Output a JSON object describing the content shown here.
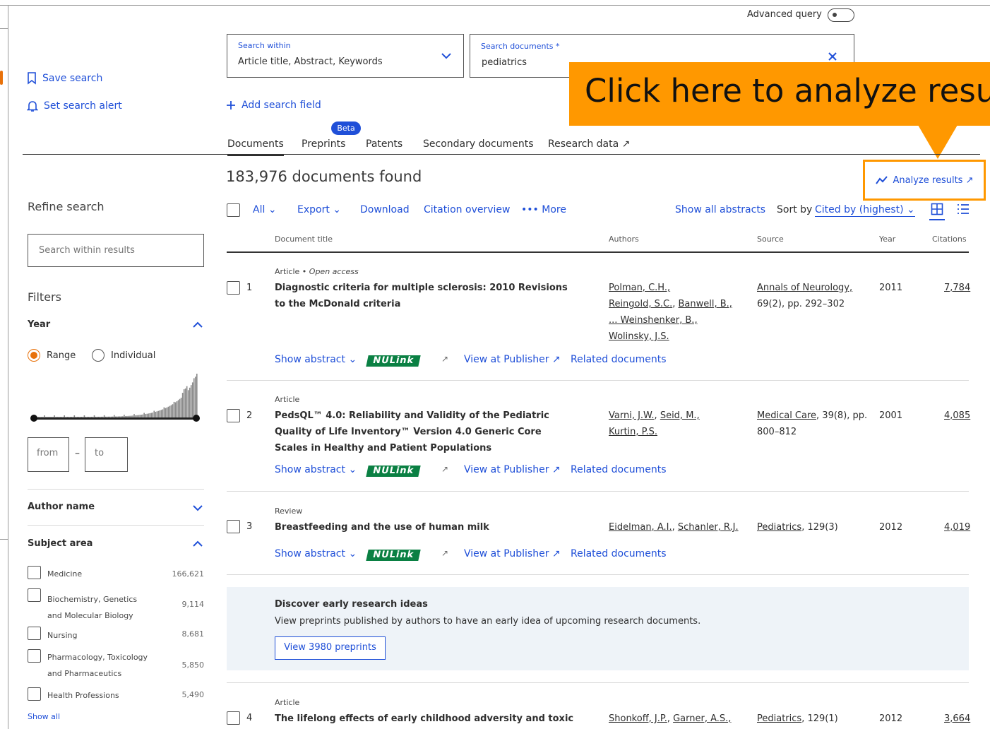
{
  "header": {
    "advanced_query_label": "Advanced query",
    "search_within_label": "Search within",
    "search_within_value": "Article title, Abstract, Keywords",
    "search_documents_label": "Search documents *",
    "search_documents_value": "pediatrics",
    "add_search_field": "Add search field",
    "save_search": "Save search",
    "set_search_alert": "Set search alert"
  },
  "tabs": {
    "beta_badge": "Beta",
    "items": [
      "Documents",
      "Preprints",
      "Patents",
      "Secondary documents",
      "Research data ↗"
    ]
  },
  "callout": {
    "text": "Click here to analyze resu"
  },
  "results": {
    "count_text": "183,976 documents found",
    "analyze_results": "Analyze results ↗"
  },
  "toolbar": {
    "all": "All",
    "export": "Export",
    "download": "Download",
    "citation_overview": "Citation overview",
    "more": "More",
    "show_all_abstracts": "Show all abstracts",
    "sort_by_label": "Sort by",
    "sort_by_value": "Cited by (highest)"
  },
  "columns": {
    "title": "Document title",
    "authors": "Authors",
    "source": "Source",
    "year": "Year",
    "citations": "Citations"
  },
  "row_actions": {
    "show_abstract": "Show abstract",
    "nulink": "NULink",
    "view_publisher": "View at Publisher ↗",
    "related": "Related documents"
  },
  "documents": [
    {
      "num": "1",
      "type": "Article",
      "open_access": "Open access",
      "title": "Diagnostic criteria for multiple sclerosis: 2010 Revisions to the McDonald criteria",
      "authors_line1": "Polman, C.H.,",
      "authors_line2a": "Reingold, S.C.",
      "authors_line2b": "Banwell, B.,",
      "authors_line3": "... Weinshenker, B.,",
      "authors_line4": "Wolinsky, J.S.",
      "source_name": "Annals of Neurology,",
      "source_detail": "69(2), pp. 292–302",
      "year": "2011",
      "citations": "7,784"
    },
    {
      "num": "2",
      "type": "Article",
      "title": "PedsQL™ 4.0: Reliability and Validity of the Pediatric Quality of Life Inventory™ Version 4.0 Generic Core Scales in Healthy and Patient Populations",
      "authors_line1a": "Varni, J.W.",
      "authors_line1b": "Seid, M.,",
      "authors_line2": "Kurtin, P.S.",
      "source_name": "Medical Care",
      "source_detail_a": ", 39(8), pp.",
      "source_detail_b": "800–812",
      "year": "2001",
      "citations": "4,085"
    },
    {
      "num": "3",
      "type": "Review",
      "title": "Breastfeeding and the use of human milk",
      "authors_a": "Eidelman, A.I.",
      "authors_b": "Schanler, R.J.",
      "source_name": "Pediatrics",
      "source_detail": ", 129(3)",
      "year": "2012",
      "citations": "4,019"
    },
    {
      "num": "4",
      "type": "Article",
      "title": "The lifelong effects of early childhood adversity and toxic stress",
      "authors_a": "Shonkoff, J.P.",
      "authors_b": "Garner, A.S.,",
      "source_name": "Pediatrics",
      "source_detail": ", 129(1)",
      "year": "2012",
      "citations": "3,664"
    }
  ],
  "promo": {
    "title": "Discover early research ideas",
    "text": "View preprints published by authors to have an early idea of upcoming research documents.",
    "button": "View 3980 preprints"
  },
  "sidebar": {
    "refine_search": "Refine search",
    "search_within_results_placeholder": "Search within results",
    "filters": "Filters",
    "year": "Year",
    "range": "Range",
    "individual": "Individual",
    "from": "from",
    "dash": "–",
    "to": "to",
    "author_name": "Author name",
    "subject_area": "Subject area",
    "subjects": [
      {
        "line1": "Medicine",
        "line2": "",
        "count": "166,621"
      },
      {
        "line1": "Biochemistry, Genetics",
        "line2": "and Molecular Biology",
        "count": "9,114"
      },
      {
        "line1": "Nursing",
        "line2": "",
        "count": "8,681"
      },
      {
        "line1": "Pharmacology, Toxicology",
        "line2": "and Pharmaceutics",
        "count": "5,850"
      },
      {
        "line1": "Health Professions",
        "line2": "",
        "count": "5,490"
      }
    ],
    "show_all": "Show all"
  },
  "colors": {
    "accent_orange": "#ff9800",
    "link_blue": "#1f4fd8",
    "radio_orange": "#e8710a",
    "nulink_green": "#0a8043"
  }
}
